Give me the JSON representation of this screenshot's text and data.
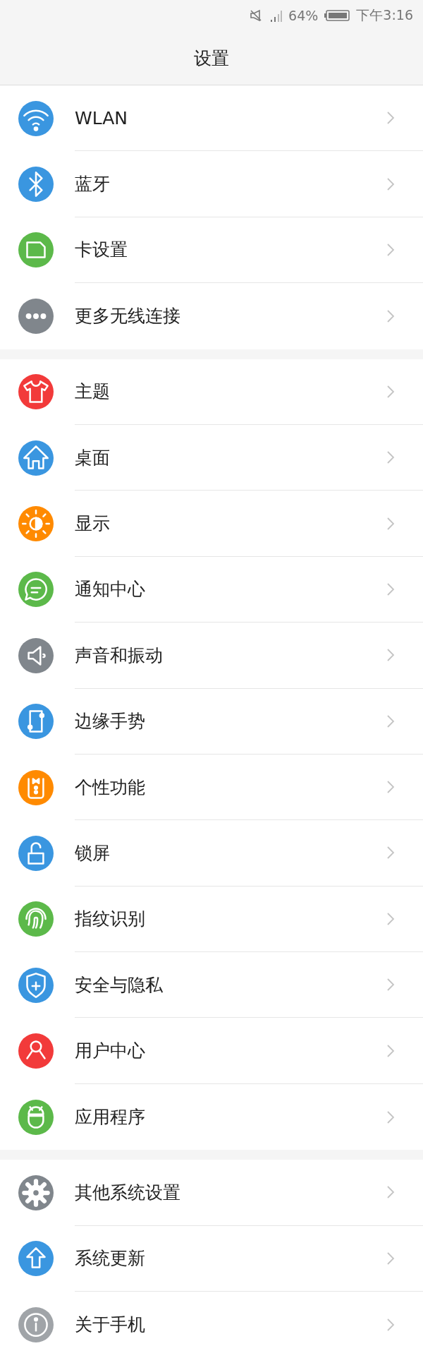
{
  "status_bar": {
    "battery_percent": "64%",
    "time": "下午3:16"
  },
  "header": {
    "title": "设置"
  },
  "groups": [
    {
      "items": [
        {
          "label": "WLAN",
          "color": "#3a96e0"
        },
        {
          "label": "蓝牙",
          "color": "#3a96e0"
        },
        {
          "label": "卡设置",
          "color": "#5cb94a"
        },
        {
          "label": "更多无线连接",
          "color": "#80868c"
        }
      ]
    },
    {
      "items": [
        {
          "label": "主题",
          "color": "#f23a3a"
        },
        {
          "label": "桌面",
          "color": "#3a96e0"
        },
        {
          "label": "显示",
          "color": "#ff8a00"
        },
        {
          "label": "通知中心",
          "color": "#5cb94a"
        },
        {
          "label": "声音和振动",
          "color": "#80868c"
        },
        {
          "label": "边缘手势",
          "color": "#3a96e0"
        },
        {
          "label": "个性功能",
          "color": "#ff8a00"
        },
        {
          "label": "锁屏",
          "color": "#3a96e0"
        },
        {
          "label": "指纹识别",
          "color": "#5cb94a"
        },
        {
          "label": "安全与隐私",
          "color": "#3a96e0"
        },
        {
          "label": "用户中心",
          "color": "#f23a3a"
        },
        {
          "label": "应用程序",
          "color": "#5cb94a"
        }
      ]
    },
    {
      "items": [
        {
          "label": "其他系统设置",
          "color": "#80868c"
        },
        {
          "label": "系统更新",
          "color": "#3a96e0"
        },
        {
          "label": "关于手机",
          "color": "#a0a4a8"
        }
      ]
    }
  ]
}
